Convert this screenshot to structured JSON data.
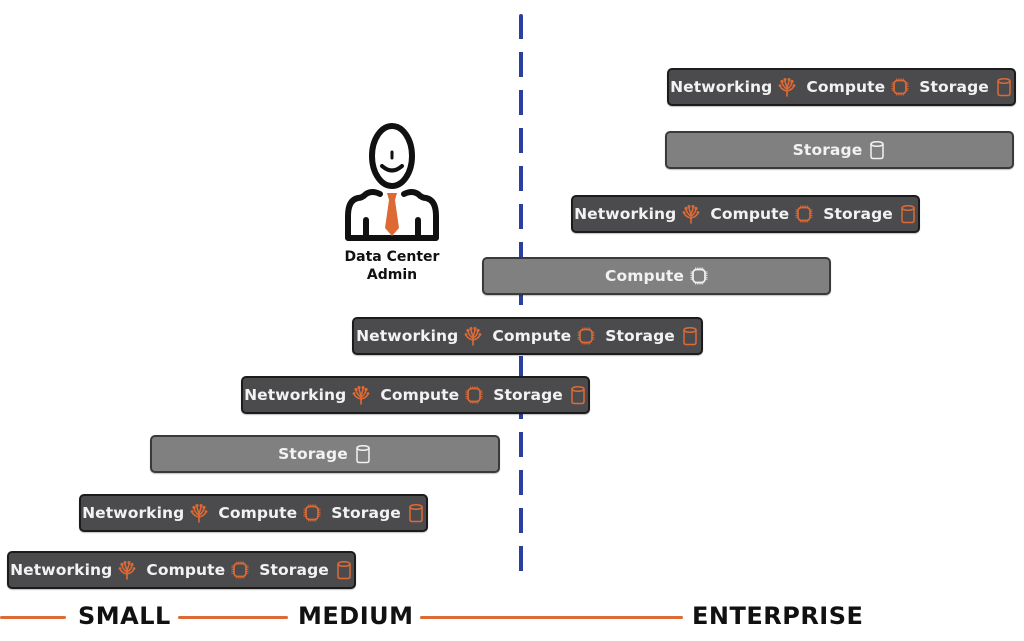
{
  "colors": {
    "accent": "#dd6a35",
    "divider": "#2b3fa0",
    "bar_dark": "#4b4b4d",
    "bar_light": "#7f807f",
    "bar_text": "#f2f2f2"
  },
  "admin": {
    "icon": "person-with-tie-icon",
    "caption_line1": "Data Center",
    "caption_line2": "Admin"
  },
  "bars": [
    {
      "style": "dark",
      "items": [
        {
          "label": "Networking",
          "icon": "network-icon"
        },
        {
          "label": "Compute",
          "icon": "chip-icon"
        },
        {
          "label": "Storage",
          "icon": "database-icon"
        }
      ]
    },
    {
      "style": "light",
      "items": [
        {
          "label": "Storage",
          "icon": "database-icon"
        }
      ]
    },
    {
      "style": "dark",
      "items": [
        {
          "label": "Networking",
          "icon": "network-icon"
        },
        {
          "label": "Compute",
          "icon": "chip-icon"
        },
        {
          "label": "Storage",
          "icon": "database-icon"
        }
      ]
    },
    {
      "style": "light",
      "items": [
        {
          "label": "Compute",
          "icon": "chip-icon"
        }
      ]
    },
    {
      "style": "dark",
      "items": [
        {
          "label": "Networking",
          "icon": "network-icon"
        },
        {
          "label": "Compute",
          "icon": "chip-icon"
        },
        {
          "label": "Storage",
          "icon": "database-icon"
        }
      ]
    },
    {
      "style": "dark",
      "items": [
        {
          "label": "Networking",
          "icon": "network-icon"
        },
        {
          "label": "Compute",
          "icon": "chip-icon"
        },
        {
          "label": "Storage",
          "icon": "database-icon"
        }
      ]
    },
    {
      "style": "light",
      "items": [
        {
          "label": "Storage",
          "icon": "database-icon"
        }
      ]
    },
    {
      "style": "dark",
      "items": [
        {
          "label": "Networking",
          "icon": "network-icon"
        },
        {
          "label": "Compute",
          "icon": "chip-icon"
        },
        {
          "label": "Storage",
          "icon": "database-icon"
        }
      ]
    },
    {
      "style": "dark",
      "items": [
        {
          "label": "Networking",
          "icon": "network-icon"
        },
        {
          "label": "Compute",
          "icon": "chip-icon"
        },
        {
          "label": "Storage",
          "icon": "database-icon"
        }
      ]
    }
  ],
  "scale": {
    "small": "SMALL",
    "medium": "MEDIUM",
    "enterprise": "ENTERPRISE"
  }
}
